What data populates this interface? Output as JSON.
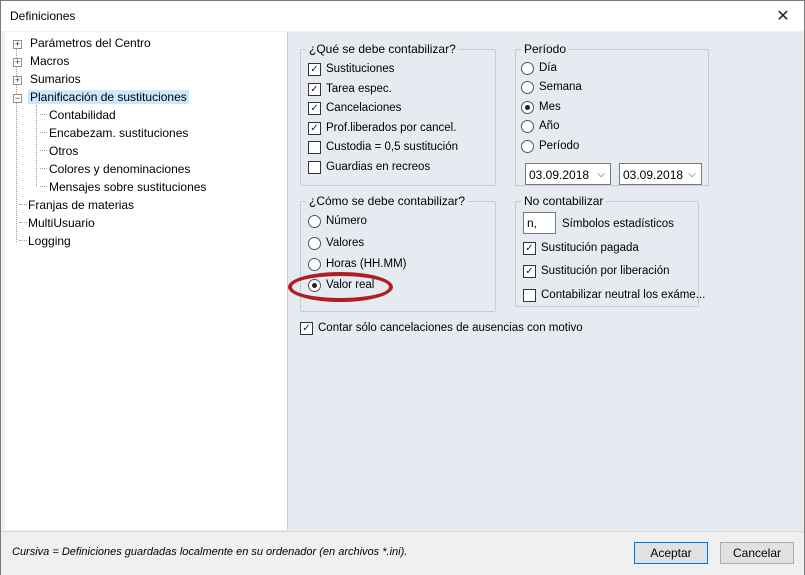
{
  "window": {
    "title": "Definiciones",
    "close_glyph": "✕"
  },
  "tree": {
    "items": [
      {
        "label": "Parámetros del Centro",
        "expander": "+"
      },
      {
        "label": "Macros",
        "expander": "+"
      },
      {
        "label": "Sumarios",
        "expander": "+"
      },
      {
        "label": "Planificación de sustituciones",
        "expander": "−",
        "selected": true
      },
      {
        "label": "Contabilidad"
      },
      {
        "label": "Encabezam. sustituciones"
      },
      {
        "label": "Otros"
      },
      {
        "label": "Colores y denominaciones"
      },
      {
        "label": "Mensajes sobre sustituciones"
      },
      {
        "label": "Franjas de materias"
      },
      {
        "label": "MultiUsuario"
      },
      {
        "label": "Logging"
      }
    ]
  },
  "what_group": {
    "legend": "¿Qué se debe contabilizar?",
    "items": [
      {
        "label": "Sustituciones",
        "checked": true
      },
      {
        "label": "Tarea espec.",
        "checked": true
      },
      {
        "label": "Cancelaciones",
        "checked": true
      },
      {
        "label": "Prof.liberados por cancel.",
        "checked": true
      },
      {
        "label": "Custodia = 0,5 sustitución",
        "checked": false
      },
      {
        "label": "Guardias en recreos",
        "checked": false
      }
    ]
  },
  "period_group": {
    "legend": "Período",
    "options": [
      {
        "label": "Día",
        "selected": false
      },
      {
        "label": "Semana",
        "selected": false
      },
      {
        "label": "Mes",
        "selected": true
      },
      {
        "label": "Año",
        "selected": false
      },
      {
        "label": "Período",
        "selected": false
      }
    ],
    "date_from": "03.09.2018",
    "date_to": "03.09.2018",
    "dropdown_glyph": "⌵"
  },
  "how_group": {
    "legend": "¿Cómo se debe contabilizar?",
    "options": [
      {
        "label": "Número",
        "selected": false
      },
      {
        "label": "Valores",
        "selected": false
      },
      {
        "label": "Horas (HH.MM)",
        "selected": false
      },
      {
        "label": "Valor real",
        "selected": true
      }
    ]
  },
  "no_group": {
    "legend": "No contabilizar",
    "symbol_value": "n,",
    "symbol_label": "Símbolos estadísticos",
    "items": [
      {
        "label": "Sustitución pagada",
        "checked": true
      },
      {
        "label": "Sustitución por liberación",
        "checked": true
      },
      {
        "label": "Contabilizar neutral los exáme...",
        "checked": false
      }
    ]
  },
  "only_reason": {
    "label": "Contar sólo cancelaciones de ausencias con motivo",
    "checked": true
  },
  "footer": {
    "hint": "Cursiva = Definiciones guardadas localmente en su ordenador (en archivos *.ini).",
    "accept_label": "Aceptar",
    "cancel_label": "Cancelar"
  },
  "colors": {
    "annotation_ring": "#b01d22",
    "content_bg": "#e6ebf1",
    "selection_bg": "#cce8ff"
  }
}
